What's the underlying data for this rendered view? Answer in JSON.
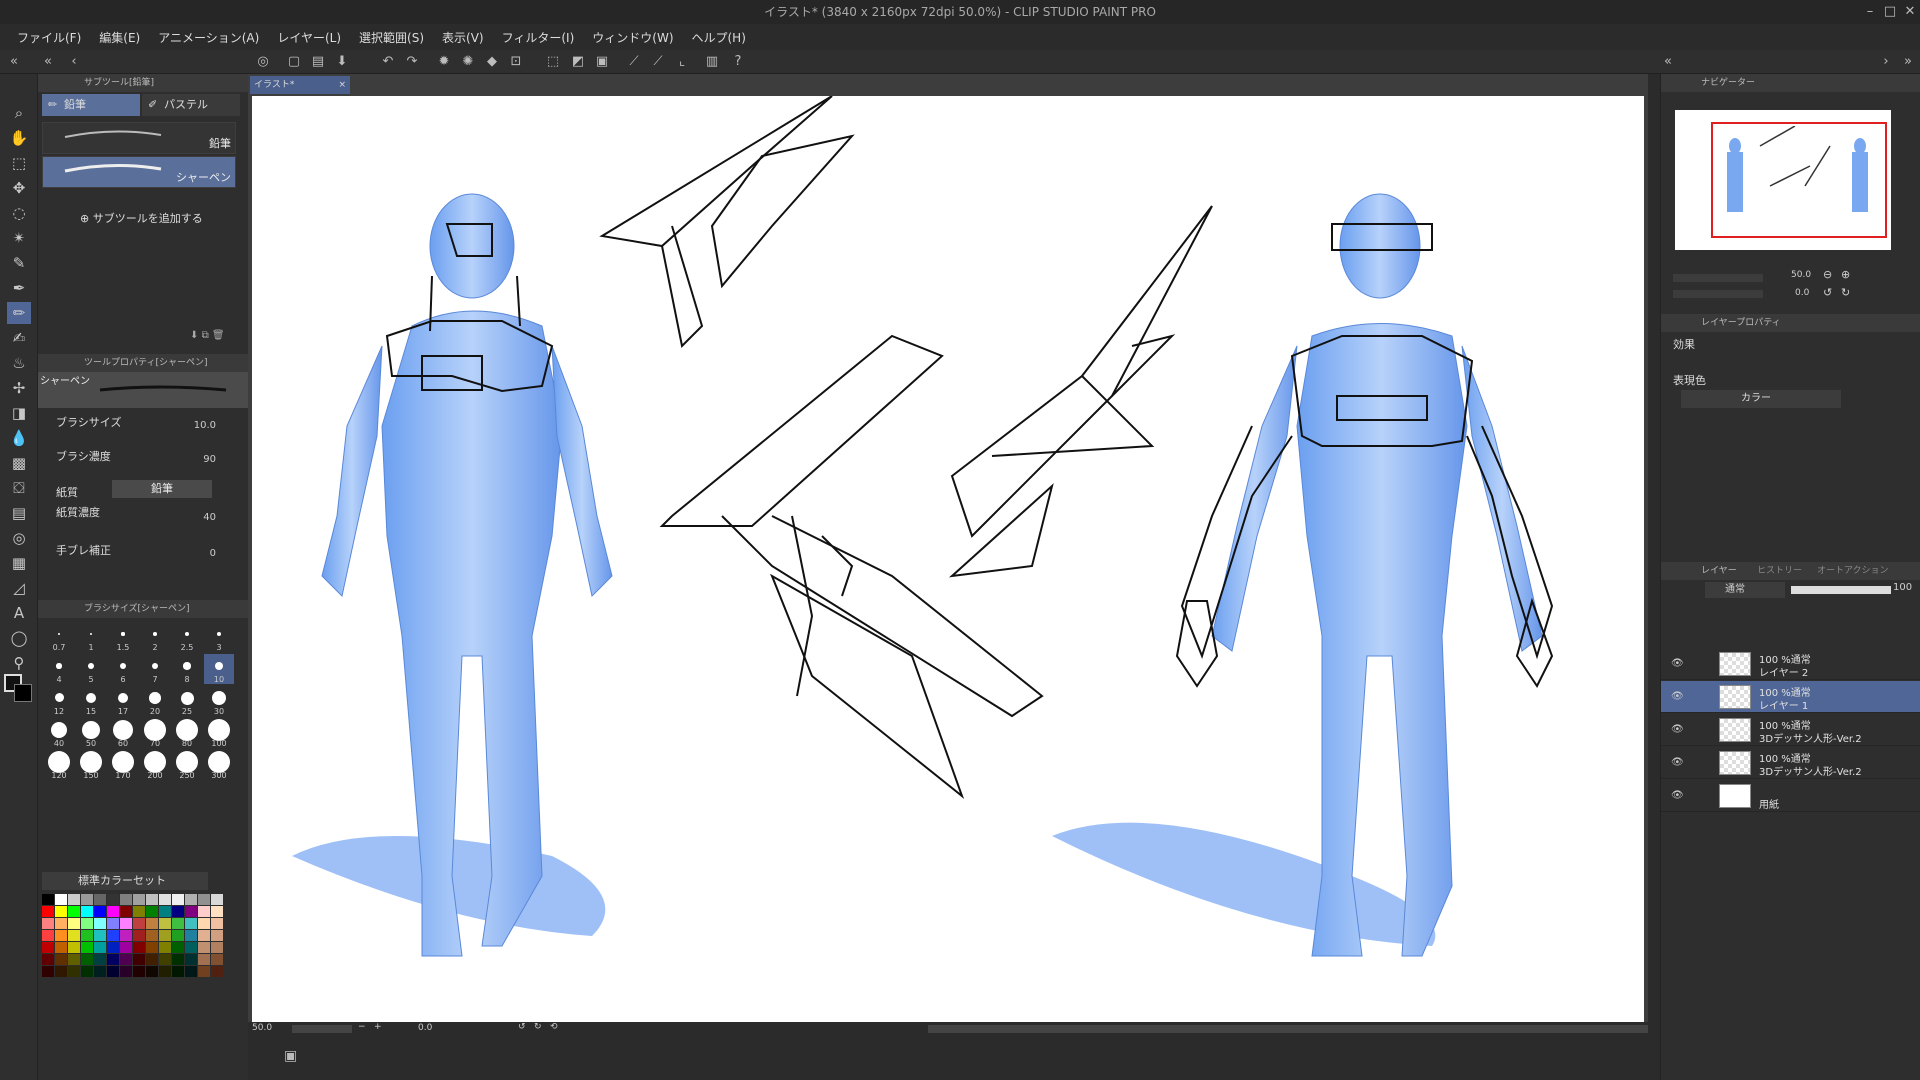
{
  "title": "イラスト* (3840 x 2160px 72dpi 50.0%)  - CLIP STUDIO PAINT PRO",
  "menu": [
    "ファイル(F)",
    "編集(E)",
    "アニメーション(A)",
    "レイヤー(L)",
    "選択範囲(S)",
    "表示(V)",
    "フィルター(I)",
    "ウィンドウ(W)",
    "ヘルプ(H)"
  ],
  "subtool": {
    "header": "サブツール[鉛筆]",
    "tabs": [
      "鉛筆",
      "パステル"
    ],
    "brushes": [
      {
        "name": "鉛筆"
      },
      {
        "name": "シャーペン",
        "selected": true
      }
    ],
    "add_label": "サブツールを追加する"
  },
  "toolprop": {
    "header": "ツールプロパティ[シャーペン]",
    "preview_name": "シャーペン",
    "props": [
      {
        "label": "ブラシサイズ",
        "value": "10.0"
      },
      {
        "label": "ブラシ濃度",
        "value": "90"
      },
      {
        "label": "紙質",
        "value": "鉛筆"
      },
      {
        "label": "紙質濃度",
        "value": "40"
      },
      {
        "label": "手ブレ補正",
        "value": "0"
      }
    ]
  },
  "brushsize": {
    "header": "ブラシサイズ[シャーペン]",
    "sizes": [
      "0.7",
      "1",
      "1.5",
      "2",
      "2.5",
      "3",
      "4",
      "5",
      "6",
      "7",
      "8",
      "10",
      "12",
      "15",
      "17",
      "20",
      "25",
      "30",
      "40",
      "50",
      "60",
      "70",
      "80",
      "100",
      "120",
      "150",
      "170",
      "200",
      "250",
      "300"
    ],
    "selected": "10"
  },
  "colorset": {
    "name": "標準カラーセット"
  },
  "document": {
    "tab": "イラスト*"
  },
  "status": {
    "zoom": "50.0",
    "angle": "0.0"
  },
  "navigator": {
    "header": "ナビゲーター",
    "zoom": "50.0",
    "angle": "0.0"
  },
  "layerprop": {
    "header": "レイヤープロパティ",
    "effect_label": "効果",
    "color_label": "表現色",
    "color_value": "カラー"
  },
  "layers": {
    "tabs": [
      "レイヤー",
      "ヒストリー",
      "オートアクション"
    ],
    "blend": "通常",
    "opacity": "100",
    "items": [
      {
        "line1": "100 %通常",
        "line2": "レイヤー 2",
        "selected": false
      },
      {
        "line1": "100 %通常",
        "line2": "レイヤー 1",
        "selected": true
      },
      {
        "line1": "100 %通常",
        "line2": "3Dデッサン人形-Ver.2",
        "selected": false
      },
      {
        "line1": "100 %通常",
        "line2": "3Dデッサン人形-Ver.2",
        "selected": false
      },
      {
        "line1": "",
        "line2": "用紙",
        "selected": false
      }
    ]
  },
  "colors": {
    "accent": "#4f6696",
    "figure": "#7aa8f0",
    "paper": "#ffffff"
  }
}
